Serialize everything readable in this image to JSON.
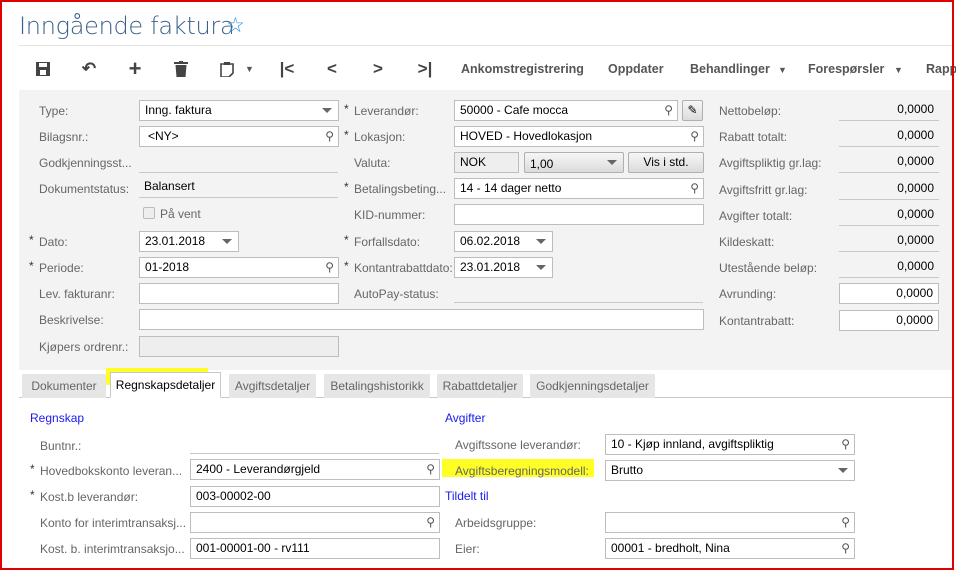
{
  "header": {
    "title": "Inngående faktura",
    "favorite_icon": "star-outline-icon"
  },
  "toolbar": {
    "icons": [
      "save-icon",
      "undo-icon",
      "add-icon",
      "delete-icon",
      "paste-icon",
      "first-icon",
      "previous-icon",
      "next-icon",
      "last-icon"
    ],
    "ankomst": "Ankomstregistrering",
    "oppdater": "Oppdater",
    "behandlinger": "Behandlinger",
    "foresporsler": "Forespørsler",
    "rapp": "Rapp"
  },
  "form": {
    "type_label": "Type:",
    "type_value": "Inng. faktura",
    "bilag_label": "Bilagsnr.:",
    "bilag_value": "<NY>",
    "godkj_label": "Godkjenningsst...",
    "godkj_value": "",
    "dokstatus_label": "Dokumentstatus:",
    "dokstatus_value": "Balansert",
    "pavent_label": "På vent",
    "dato_label": "Dato:",
    "dato_value": "23.01.2018",
    "periode_label": "Periode:",
    "periode_value": "01-2018",
    "levfakt_label": "Lev. fakturanr:",
    "levfakt_value": "",
    "beskr_label": "Beskrivelse:",
    "beskr_value": "",
    "kjopers_label": "Kjøpers ordrenr.:",
    "kjopers_value": "",
    "leverandor_label": "Leverandør:",
    "leverandor_value": "50000 - Cafe mocca",
    "lokasjon_label": "Lokasjon:",
    "lokasjon_value": "HOVED - Hovedlokasjon",
    "valuta_label": "Valuta:",
    "valuta_value": "NOK",
    "kurs_value": "1,00",
    "vis_label": "Vis i std.",
    "betaling_label": "Betalingsbeting...",
    "betaling_value": "14 - 14 dager netto",
    "kid_label": "KID-nummer:",
    "kid_value": "",
    "forfall_label": "Forfallsdato:",
    "forfall_value": "06.02.2018",
    "kontantdato_label": "Kontantrabattdato:",
    "kontantdato_value": "23.01.2018",
    "autopay_label": "AutoPay-status:",
    "autopay_value": ""
  },
  "totals": [
    {
      "label": "Nettobeløp:",
      "value": "0,0000",
      "editable": false
    },
    {
      "label": "Rabatt totalt:",
      "value": "0,0000",
      "editable": false
    },
    {
      "label": "Avgiftspliktig gr.lag:",
      "value": "0,0000",
      "editable": false
    },
    {
      "label": "Avgiftsfritt gr.lag:",
      "value": "0,0000",
      "editable": false
    },
    {
      "label": "Avgifter totalt:",
      "value": "0,0000",
      "editable": false
    },
    {
      "label": "Kildeskatt:",
      "value": "0,0000",
      "editable": false
    },
    {
      "label": "Utestående beløp:",
      "value": "0,0000",
      "editable": false
    },
    {
      "label": "Avrunding:",
      "value": "0,0000",
      "editable": true
    },
    {
      "label": "Kontantrabatt:",
      "value": "0,0000",
      "editable": true
    }
  ],
  "tabs": [
    {
      "label": "Dokumenter"
    },
    {
      "label": "Regnskapsdetaljer",
      "active": true
    },
    {
      "label": "Avgiftsdetaljer"
    },
    {
      "label": "Betalingshistorikk"
    },
    {
      "label": "Rabattdetaljer"
    },
    {
      "label": "Godkjenningsdetaljer"
    }
  ],
  "regnskap": {
    "title": "Regnskap",
    "buntnr_label": "Buntnr.:",
    "buntnr_value": "",
    "hovedbok_label": "Hovedbokskonto leveran...",
    "hovedbok_value": "2400 - Leverandørgjeld",
    "kostb_label": "Kost.b leverandør:",
    "kostb_value": "003-00002-00",
    "konto_interim_label": "Konto for interimtransaksj...",
    "konto_interim_value": "",
    "kostb_interim_label": "Kost. b. interimtransaksjo...",
    "kostb_interim_value": "001-00001-00 - rv111"
  },
  "avgifter": {
    "title": "Avgifter",
    "sone_label": "Avgiftssone leverandør:",
    "sone_value": "10 - Kjøp innland, avgiftspliktig",
    "modell_label": "Avgiftsberegningsmodell:",
    "modell_value": "Brutto"
  },
  "tildelt": {
    "title": "Tildelt til",
    "arbeid_label": "Arbeidsgruppe:",
    "arbeid_value": "",
    "eier_label": "Eier:",
    "eier_value": "00001 - bredholt, Nina"
  },
  "colors": {
    "highlight": "#ffff00",
    "border": "#e00000",
    "section": "#1a1aee"
  }
}
